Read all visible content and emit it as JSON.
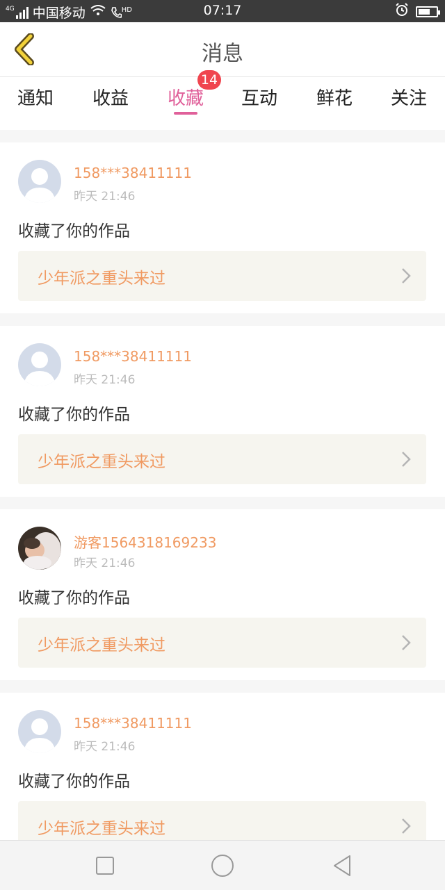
{
  "status_bar": {
    "carrier": "中国移动",
    "network": "4G",
    "hd": "HD",
    "time": "07:17"
  },
  "navbar": {
    "title": "消息"
  },
  "tabs": [
    {
      "label": "通知"
    },
    {
      "label": "收益"
    },
    {
      "label": "收藏",
      "active": true,
      "badge": "14"
    },
    {
      "label": "互动"
    },
    {
      "label": "鲜花"
    },
    {
      "label": "关注"
    }
  ],
  "colors": {
    "accent_pink": "#e0609a",
    "username_orange": "#f09a62",
    "badge_red": "#f0454f"
  },
  "messages": [
    {
      "user": "158***38411111",
      "time": "昨天 21:46",
      "action": "收藏了你的作品",
      "work": "少年派之重头来过",
      "avatar": "default-avatar-icon"
    },
    {
      "user": "158***38411111",
      "time": "昨天 21:46",
      "action": "收藏了你的作品",
      "work": "少年派之重头来过",
      "avatar": "default-avatar-icon"
    },
    {
      "user": "游客1564318169233",
      "time": "昨天 21:46",
      "action": "收藏了你的作品",
      "work": "少年派之重头来过",
      "avatar": "photo-avatar"
    },
    {
      "user": "158***38411111",
      "time": "昨天 21:46",
      "action": "收藏了你的作品",
      "work": "少年派之重头来过",
      "avatar": "default-avatar-icon"
    }
  ],
  "bottom_nav": {
    "icons": [
      "recent-apps-icon",
      "home-icon",
      "back-icon"
    ]
  }
}
